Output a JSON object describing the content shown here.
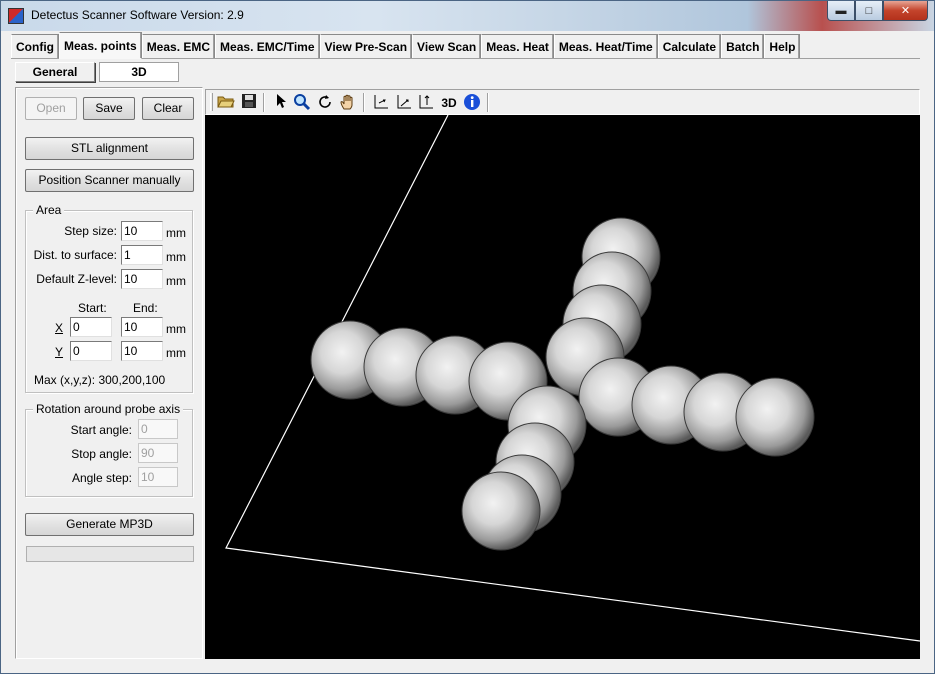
{
  "window": {
    "title": "Detectus Scanner Software Version: 2.9"
  },
  "tabs": [
    {
      "label": "Config"
    },
    {
      "label": "Meas. points",
      "active": true
    },
    {
      "label": "Meas. EMC"
    },
    {
      "label": "Meas. EMC/Time"
    },
    {
      "label": "View Pre-Scan"
    },
    {
      "label": "View Scan"
    },
    {
      "label": "Meas. Heat"
    },
    {
      "label": "Meas. Heat/Time"
    },
    {
      "label": "Calculate"
    },
    {
      "label": "Batch"
    },
    {
      "label": "Help"
    }
  ],
  "subtabs": {
    "general": "General",
    "threed": "3D"
  },
  "left": {
    "open": "Open",
    "save": "Save",
    "clear": "Clear",
    "stl_alignment": "STL alignment",
    "position_manually": "Position Scanner manually",
    "area": {
      "title": "Area",
      "step_size_label": "Step size:",
      "step_size": "10",
      "dist_label": "Dist. to surface:",
      "dist": "1",
      "zlevel_label": "Default Z-level:",
      "zlevel": "10",
      "unit": "mm",
      "start_label": "Start:",
      "end_label": "End:",
      "x_label": "X",
      "y_label": "Y",
      "x_start": "0",
      "x_end": "10",
      "y_start": "0",
      "y_end": "10",
      "max_label": "Max (x,y,z): 300,200,100"
    },
    "rotation": {
      "title": "Rotation around probe axis",
      "start_label": "Start angle:",
      "start": "0",
      "stop_label": "Stop angle:",
      "stop": "90",
      "step_label": "Angle step:",
      "step": "10"
    },
    "generate": "Generate MP3D",
    "progress": 0
  },
  "toolbar": {
    "icons": [
      "open-folder-icon",
      "save-disk-icon",
      "pointer-icon",
      "zoom-icon",
      "rotate-icon",
      "pan-hand-icon",
      "axis-x-icon",
      "axis-y-icon",
      "axis-z-icon",
      "3d-view-icon",
      "info-icon"
    ],
    "threed_label": "3D",
    "info_color": "#1a4fd8"
  }
}
